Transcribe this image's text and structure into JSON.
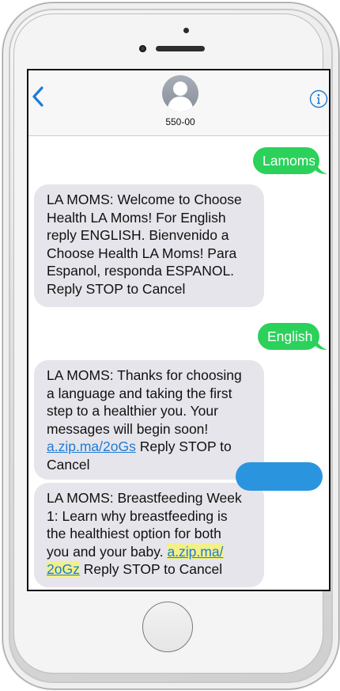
{
  "contact": {
    "name": "550-00"
  },
  "icons": {
    "back": "chevron-left-icon",
    "info": "info-circle-icon",
    "avatar": "person-silhouette-icon"
  },
  "colors": {
    "accent": "#1e7bd6",
    "outgoing_bubble": "#2bd15a",
    "incoming_bubble": "#e6e5eb",
    "link_highlight": "#f2f08a"
  },
  "messages": [
    {
      "direction": "outgoing",
      "text": "Lamoms"
    },
    {
      "direction": "incoming",
      "lines": [
        "LA MOMS: Welcome to Choose",
        "Health LA Moms! For English",
        "reply ENGLISH. Bienvenido a",
        "Choose Health LA Moms! Para",
        "Espanol, responda ESPANOL.",
        "Reply STOP to Cancel"
      ]
    },
    {
      "direction": "outgoing",
      "text": "English"
    },
    {
      "direction": "incoming",
      "lines": [
        "LA MOMS: Thanks for choosing",
        "a language and taking the first",
        "step to a healthier you. Your",
        "messages will begin soon!"
      ],
      "link": "a.zip.ma/2oGs",
      "after_link": "Reply STOP to",
      "last_line": "Cancel"
    },
    {
      "direction": "incoming",
      "lines": [
        "LA MOMS: Breastfeeding Week",
        "1: Learn why breastfeeding is",
        "the healthiest option for both"
      ],
      "line4_prefix": "you and your baby.",
      "link_part1": "a.zip.ma/",
      "link_part2": "2oGz",
      "after_link": "Reply STOP to Cancel"
    }
  ]
}
